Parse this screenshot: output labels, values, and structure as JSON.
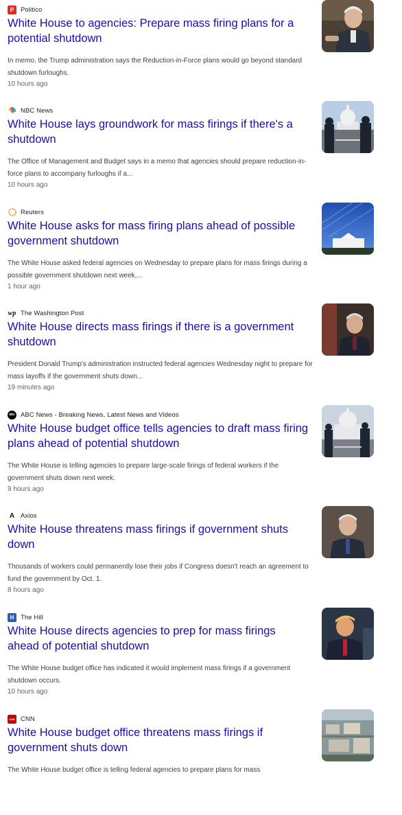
{
  "articles": [
    {
      "source": "Politico",
      "logo_text": "P",
      "logo_color": "#d8312b",
      "title": "White House to agencies: Prepare mass firing plans for a potential shutdown",
      "snippet": "In memo, the Trump administration says the Reduction-in-Force plans would go beyond standard shutdown furloughs.",
      "time": "10 hours ago"
    },
    {
      "source": "NBC News",
      "logo_text": "",
      "logo_color": "#ffffff",
      "title": "White House lays groundwork for mass firings if there's a shutdown",
      "snippet": "The Office of Management and Budget says in a memo that agencies should prepare reduction-in-force plans to accompany furloughs if a...",
      "time": "10 hours ago"
    },
    {
      "source": "Reuters",
      "logo_text": "",
      "logo_color": "#ffffff",
      "title": "White House asks for mass firing plans ahead of possible government shutdown",
      "snippet": "The White House asked federal agencies on Wednesday to prepare plans for mass firings during a possible government shutdown next week,...",
      "time": "1 hour ago"
    },
    {
      "source": "The Washington Post",
      "logo_text": "wp",
      "logo_color": "#ffffff",
      "title": "White House directs mass firings if there is a government shutdown",
      "snippet": "President Donald Trump's administration instructed federal agencies Wednesday night to prepare for mass layoffs if the government shuts down...",
      "time": "19 minutes ago"
    },
    {
      "source": "ABC News - Breaking News, Latest News and Videos",
      "logo_text": "abc",
      "logo_color": "#000000",
      "title": "White House budget office tells agencies to draft mass firing plans ahead of potential shutdown",
      "snippet": "The White House is telling agencies to prepare large-scale firings of federal workers if the government shuts down next week.",
      "time": "9 hours ago"
    },
    {
      "source": "Axios",
      "logo_text": "A",
      "logo_color": "#ffffff",
      "title": "White House threatens mass firings if government shuts down",
      "snippet": "Thousands of workers could permanently lose their jobs if Congress doesn't reach an agreement to fund the government by Oct. 1.",
      "time": "8 hours ago"
    },
    {
      "source": "The Hill",
      "logo_text": "H",
      "logo_color": "#2b5eb4",
      "title": "White House directs agencies to prep for mass firings ahead of potential shutdown",
      "snippet": "The White House budget office has indicated it would implement mass firings if a government shutdown occurs.",
      "time": "10 hours ago"
    },
    {
      "source": "CNN",
      "logo_text": "CNN",
      "logo_color": "#cc0000",
      "title": "White House budget office threatens mass firings if government shuts down",
      "snippet": "The White House budget office is telling federal agencies to prepare plans for mass",
      "time": ""
    }
  ]
}
